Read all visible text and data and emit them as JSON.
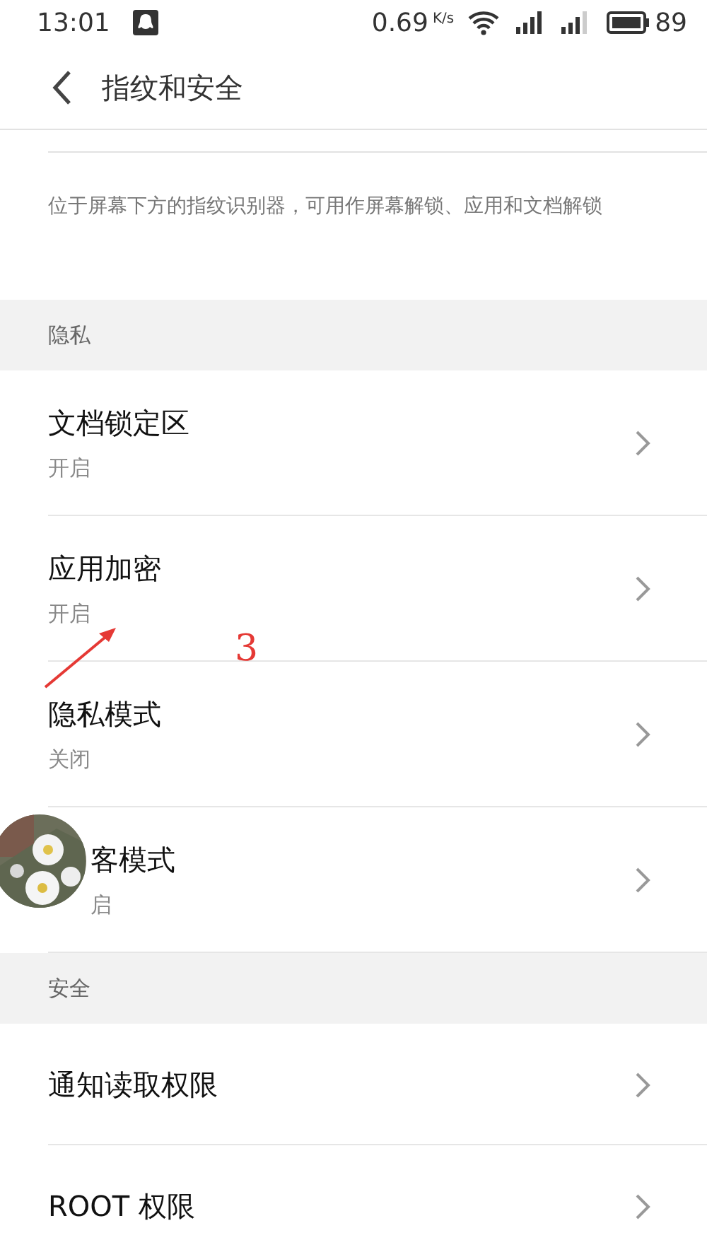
{
  "status_bar": {
    "time": "13:01",
    "speed": "0.69",
    "speed_unit": "K/s",
    "battery": "89"
  },
  "header": {
    "title": "指纹和安全"
  },
  "description": "位于屏幕下方的指纹识别器，可用作屏幕解锁、应用和文档解锁",
  "sections": [
    {
      "title": "隐私",
      "items": [
        {
          "title": "文档锁定区",
          "subtitle": "开启"
        },
        {
          "title": "应用加密",
          "subtitle": "开启"
        },
        {
          "title": "隐私模式",
          "subtitle": "关闭"
        },
        {
          "title": "客模式",
          "subtitle": "启",
          "covered": true
        }
      ]
    },
    {
      "title": "安全",
      "items": [
        {
          "title": "通知读取权限"
        },
        {
          "title": "ROOT 权限"
        }
      ]
    }
  ],
  "annotation": {
    "label": "3"
  }
}
